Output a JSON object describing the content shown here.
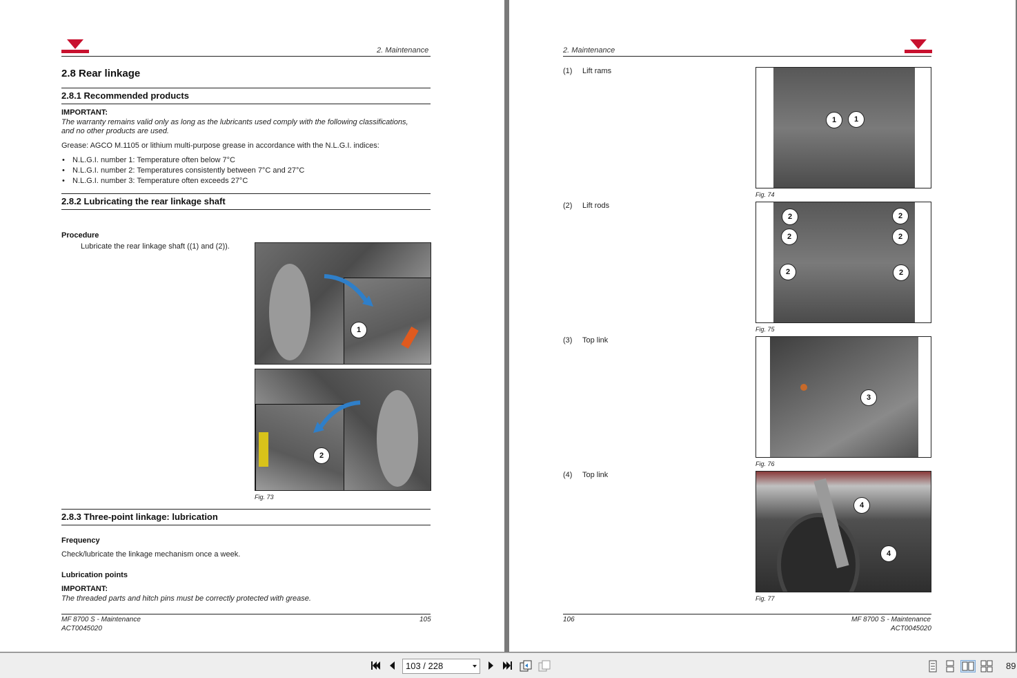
{
  "left_page": {
    "header_section": "2. Maintenance",
    "h_2_8": "2.8   Rear linkage",
    "h_2_8_1": "2.8.1  Recommended products",
    "important_label": "IMPORTANT:",
    "important_text_1": "The warranty remains valid only as long as the lubricants used comply with the following classifications,",
    "important_text_2": "and no other products are used.",
    "grease_text": "Grease: AGCO M.1105 or lithium multi-purpose grease in accordance with the N.L.G.I. indices:",
    "bullets": [
      "N.L.G.I. number 1: Temperature often below 7°C",
      "N.L.G.I. number 2: Temperatures consistently between 7°C and 27°C",
      "N.L.G.I. number 3: Temperature often exceeds 27°C"
    ],
    "h_2_8_2": "2.8.2  Lubricating the rear linkage shaft",
    "procedure_label": "Procedure",
    "procedure_text": "Lubricate the rear linkage shaft ((1) and (2)).",
    "fig73_callouts": [
      "1",
      "2"
    ],
    "fig73_caption": "Fig. 73",
    "h_2_8_3": "2.8.3  Three-point linkage: lubrication",
    "frequency_label": "Frequency",
    "frequency_text": "Check/lubricate the linkage mechanism once a week.",
    "lubpoints_label": "Lubrication points",
    "important2_label": "IMPORTANT:",
    "important2_text": "The threaded parts and hitch pins must be correctly protected with grease.",
    "footer_title": "MF 8700 S - Maintenance",
    "footer_code": "ACT0045020",
    "page_number": "105"
  },
  "right_page": {
    "header_section": "2. Maintenance",
    "items": [
      {
        "num": "(1)",
        "label": "Lift rams",
        "caption": "Fig. 74",
        "callouts": [
          "1",
          "1"
        ]
      },
      {
        "num": "(2)",
        "label": "Lift rods",
        "caption": "Fig. 75",
        "callouts": [
          "2",
          "2",
          "2",
          "2",
          "2",
          "2"
        ]
      },
      {
        "num": "(3)",
        "label": "Top link",
        "caption": "Fig. 76",
        "callouts": [
          "3"
        ]
      },
      {
        "num": "(4)",
        "label": "Top link",
        "caption": "Fig. 77",
        "callouts": [
          "4",
          "4"
        ]
      }
    ],
    "footer_title": "MF 8700 S - Maintenance",
    "footer_code": "ACT0045020",
    "page_number": "106"
  },
  "toolbar": {
    "page_indicator": "103 / 228",
    "zoom": "89",
    "first_page_icon": "first-page-icon",
    "prev_page_icon": "prev-page-icon",
    "next_page_icon": "next-page-icon",
    "last_page_icon": "last-page-icon"
  },
  "colors": {
    "brand_red": "#c8102e",
    "arrow_blue": "#2f7fc9"
  }
}
